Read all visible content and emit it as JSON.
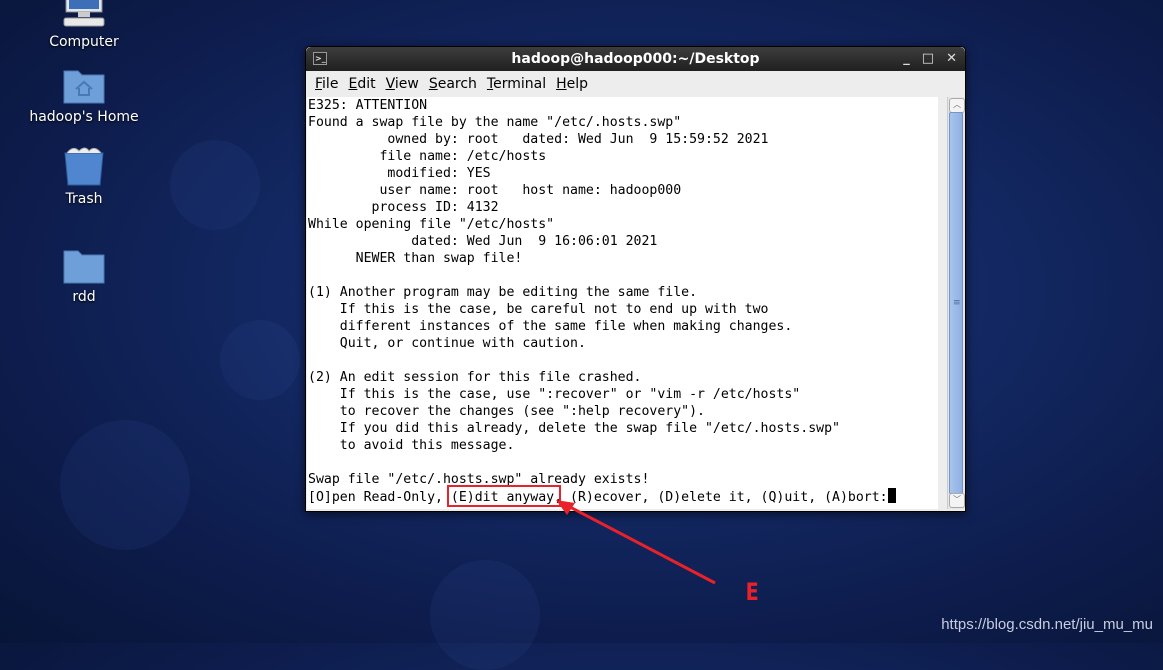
{
  "desktop": {
    "icons": [
      {
        "label": "Computer",
        "icon": "computer-icon"
      },
      {
        "label": "hadoop's Home",
        "icon": "home-folder-icon"
      },
      {
        "label": "Trash",
        "icon": "trash-icon"
      },
      {
        "label": "rdd",
        "icon": "folder-icon"
      }
    ],
    "watermark": "https://blog.csdn.net/jiu_mu_mu"
  },
  "window": {
    "title": "hadoop@hadoop000:~/Desktop",
    "controls": {
      "minimize": "_",
      "maximize": "□",
      "close": "✕"
    },
    "menu": [
      {
        "accel": "F",
        "rest": "ile"
      },
      {
        "accel": "E",
        "rest": "dit"
      },
      {
        "accel": "V",
        "rest": "iew"
      },
      {
        "accel": "S",
        "rest": "earch"
      },
      {
        "accel": "T",
        "rest": "erminal"
      },
      {
        "accel": "H",
        "rest": "elp"
      }
    ]
  },
  "terminal": {
    "lines": [
      "E325: ATTENTION",
      "Found a swap file by the name \"/etc/.hosts.swp\"",
      "          owned by: root   dated: Wed Jun  9 15:59:52 2021",
      "         file name: /etc/hosts",
      "          modified: YES",
      "         user name: root   host name: hadoop000",
      "        process ID: 4132",
      "While opening file \"/etc/hosts\"",
      "             dated: Wed Jun  9 16:06:01 2021",
      "      NEWER than swap file!",
      "",
      "(1) Another program may be editing the same file.",
      "    If this is the case, be careful not to end up with two",
      "    different instances of the same file when making changes.",
      "    Quit, or continue with caution.",
      "",
      "(2) An edit session for this file crashed.",
      "    If this is the case, use \":recover\" or \"vim -r /etc/hosts\"",
      "    to recover the changes (see \":help recovery\").",
      "    If you did this already, delete the swap file \"/etc/.hosts.swp\"",
      "    to avoid this message.",
      "",
      "Swap file \"/etc/.hosts.swp\" already exists!"
    ],
    "prompt": "[O]pen Read-Only, (E)dit anyway, (R)ecover, (D)elete it, (Q)uit, (A)bort:"
  },
  "annotation": {
    "highlighted_text": "(E)dit anyway",
    "label": "E",
    "color": "#e8212a"
  }
}
